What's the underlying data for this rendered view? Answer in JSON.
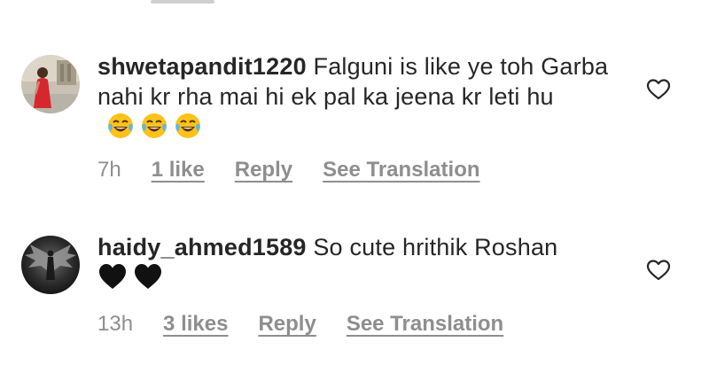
{
  "comments": [
    {
      "username": "shwetapandit1220",
      "text": "Falguni is like ye toh Garba nahi kr rha mai hi ek pal ka jeena kr leti hu",
      "emojis": [
        "face-with-tears-of-joy-icon",
        "face-with-tears-of-joy-icon",
        "face-with-tears-of-joy-icon"
      ],
      "time": "7h",
      "likes": "1 like",
      "reply": "Reply",
      "translate": "See Translation",
      "like_icon": "heart-outline-icon"
    },
    {
      "username": "haidy_ahmed1589",
      "text": "So cute hrithik Roshan",
      "emojis": [
        "black-heart-icon",
        "black-heart-icon"
      ],
      "time": "13h",
      "likes": "3 likes",
      "reply": "Reply",
      "translate": "See Translation",
      "like_icon": "heart-outline-icon"
    }
  ],
  "colors": {
    "text": "#262626",
    "secondary": "#8e8e8e"
  }
}
